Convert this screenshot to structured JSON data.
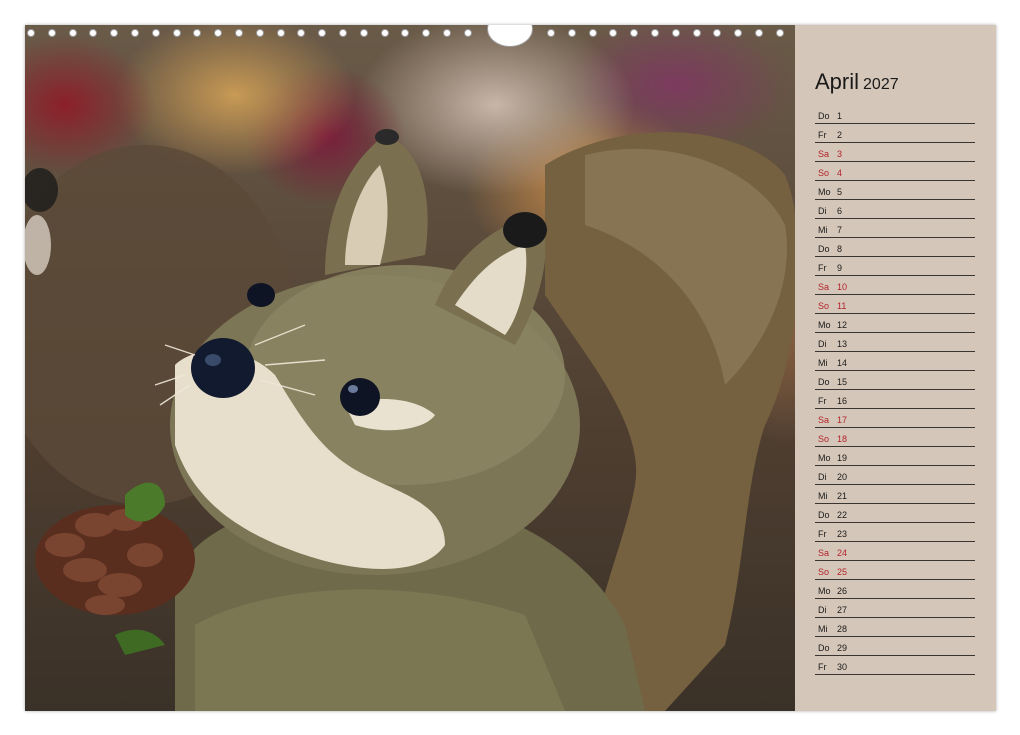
{
  "calendar": {
    "month": "April",
    "year": "2027",
    "days": [
      {
        "name": "Do",
        "num": "1",
        "weekend": false
      },
      {
        "name": "Fr",
        "num": "2",
        "weekend": false
      },
      {
        "name": "Sa",
        "num": "3",
        "weekend": true
      },
      {
        "name": "So",
        "num": "4",
        "weekend": true
      },
      {
        "name": "Mo",
        "num": "5",
        "weekend": false
      },
      {
        "name": "Di",
        "num": "6",
        "weekend": false
      },
      {
        "name": "Mi",
        "num": "7",
        "weekend": false
      },
      {
        "name": "Do",
        "num": "8",
        "weekend": false
      },
      {
        "name": "Fr",
        "num": "9",
        "weekend": false
      },
      {
        "name": "Sa",
        "num": "10",
        "weekend": true
      },
      {
        "name": "So",
        "num": "11",
        "weekend": true
      },
      {
        "name": "Mo",
        "num": "12",
        "weekend": false
      },
      {
        "name": "Di",
        "num": "13",
        "weekend": false
      },
      {
        "name": "Mi",
        "num": "14",
        "weekend": false
      },
      {
        "name": "Do",
        "num": "15",
        "weekend": false
      },
      {
        "name": "Fr",
        "num": "16",
        "weekend": false
      },
      {
        "name": "Sa",
        "num": "17",
        "weekend": true
      },
      {
        "name": "So",
        "num": "18",
        "weekend": true
      },
      {
        "name": "Mo",
        "num": "19",
        "weekend": false
      },
      {
        "name": "Di",
        "num": "20",
        "weekend": false
      },
      {
        "name": "Mi",
        "num": "21",
        "weekend": false
      },
      {
        "name": "Do",
        "num": "22",
        "weekend": false
      },
      {
        "name": "Fr",
        "num": "23",
        "weekend": false
      },
      {
        "name": "Sa",
        "num": "24",
        "weekend": true
      },
      {
        "name": "So",
        "num": "25",
        "weekend": true
      },
      {
        "name": "Mo",
        "num": "26",
        "weekend": false
      },
      {
        "name": "Di",
        "num": "27",
        "weekend": false
      },
      {
        "name": "Mi",
        "num": "28",
        "weekend": false
      },
      {
        "name": "Do",
        "num": "29",
        "weekend": false
      },
      {
        "name": "Fr",
        "num": "30",
        "weekend": false
      }
    ]
  },
  "colors": {
    "panel": "#d4c6b8",
    "weekend": "#b3232b",
    "text": "#1a1a1a"
  },
  "photo": {
    "subject": "straw-squirrel-figurine"
  }
}
